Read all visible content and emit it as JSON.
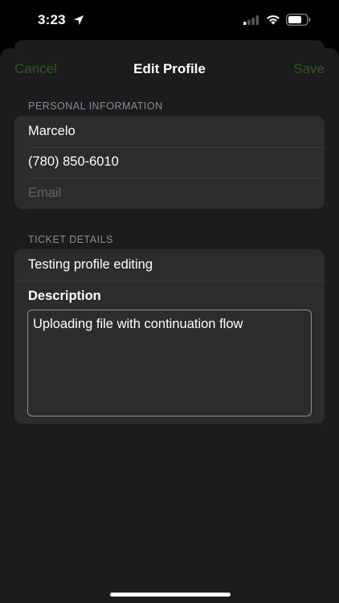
{
  "status_bar": {
    "time": "3:23",
    "icons": [
      "location-arrow-icon",
      "cellular-signal-icon",
      "wifi-icon",
      "battery-icon"
    ]
  },
  "nav": {
    "cancel_label": "Cancel",
    "title": "Edit Profile",
    "save_label": "Save"
  },
  "personal_section": {
    "header": "PERSONAL INFORMATION",
    "name_value": "Marcelo",
    "phone_value": "(780) 850-6010",
    "email_placeholder": "Email"
  },
  "ticket_section": {
    "header": "TICKET DETAILS",
    "subject_value": "Testing profile editing",
    "description_label": "Description",
    "description_value": "Uploading file with continuation flow"
  },
  "colors": {
    "accent": "#2d5a1f",
    "background": "#1c1c1e",
    "group_background": "#2c2c2e",
    "header_text": "#8d8d93"
  }
}
